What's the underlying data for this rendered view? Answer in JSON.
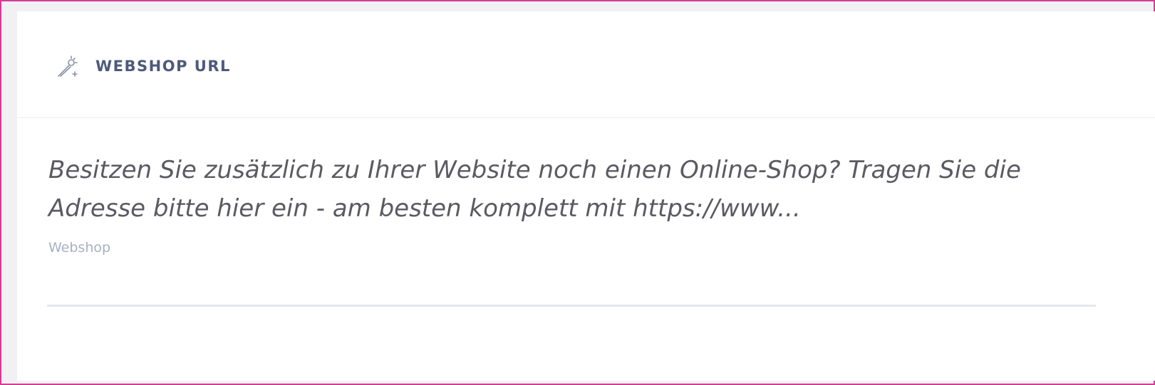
{
  "header": {
    "icon": "magic-wand-icon",
    "title": "WEBSHOP URL"
  },
  "description": "Besitzen Sie zusätzlich zu Ihrer Website noch einen Online-Shop? Tragen Sie die Adresse bitte hier ein - am besten komplett mit https://www...",
  "field": {
    "label": "Webshop",
    "value": "",
    "placeholder": ""
  },
  "colors": {
    "frame_border": "#d63b94",
    "title": "#4e5a7a",
    "label": "#a8b0c4",
    "input_underline": "#e5e6ef"
  }
}
